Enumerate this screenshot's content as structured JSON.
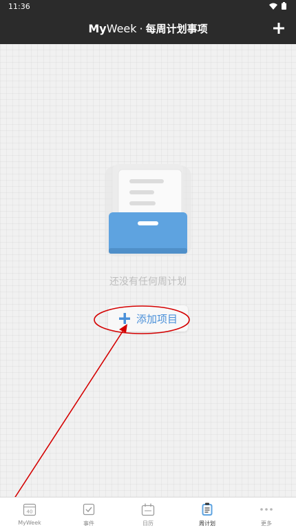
{
  "status_bar": {
    "time": "11:36",
    "wifi_icon": "wifi-icon",
    "battery_icon": "battery-icon"
  },
  "header": {
    "brand_bold": "My",
    "brand_regular": "Week",
    "separator": "·",
    "subtitle": "每周计划事项",
    "add_icon": "plus-icon",
    "background": "#2b2b2b"
  },
  "main": {
    "empty_message": "还没有任何周计划",
    "add_item_label": "添加项目",
    "accent_color": "#4a90d9",
    "illustration_icon": "empty-drawer-icon"
  },
  "tabs": [
    {
      "label": "MyWeek",
      "badge": "40",
      "icon": "week-calendar-icon"
    },
    {
      "label": "事件",
      "icon": "checkbox-icon"
    },
    {
      "label": "日历",
      "icon": "calendar-icon"
    },
    {
      "label": "周计划",
      "icon": "clipboard-icon",
      "active": true
    },
    {
      "label": "更多",
      "icon": "more-dots-icon"
    }
  ],
  "annotation": {
    "color": "#d40000"
  }
}
